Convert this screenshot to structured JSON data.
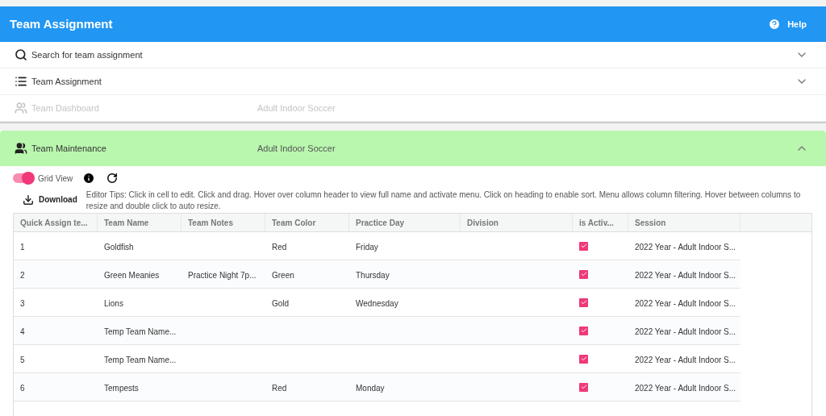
{
  "app_bar": {
    "title": "Team Assignment",
    "help": "Help"
  },
  "sections": [
    {
      "kind": "search",
      "label": "Search for team assignment",
      "expanded": false,
      "disabled": false
    },
    {
      "kind": "list",
      "label": "Team Assignment",
      "expanded": false,
      "disabled": false
    },
    {
      "kind": "people",
      "label": "Team Dashboard",
      "subtitle": "Adult Indoor Soccer",
      "disabled": true
    }
  ],
  "maintenance": {
    "label": "Team Maintenance",
    "subtitle": "Adult Indoor Soccer",
    "expanded": true
  },
  "grid_view": {
    "label": "Grid View",
    "on": true
  },
  "download": "Download",
  "tips": "Editor Tips: Click in cell to edit. Click and drag. Hover over column header to view full name and activate menu. Click on heading to enable sort. Menu allows column filtering. Hover between columns to resize and double click to auto resize.",
  "table": {
    "columns": [
      "Quick Assign te...",
      "Team Name",
      "Team Notes",
      "Team Color",
      "Practice Day",
      "Division",
      "is Activ...",
      "Session"
    ],
    "rows": [
      {
        "cells": [
          "1",
          "Goldfish",
          "",
          "Red",
          "Friday",
          ""
        ],
        "active": true,
        "session": "2022 Year - Adult Indoor S..."
      },
      {
        "cells": [
          "2",
          "Green Meanies",
          "Practice Night 7p...",
          "Green",
          "Thursday",
          ""
        ],
        "active": true,
        "session": "2022 Year - Adult Indoor S..."
      },
      {
        "cells": [
          "3",
          "Lions",
          "",
          "Gold",
          "Wednesday",
          ""
        ],
        "active": true,
        "session": "2022 Year - Adult Indoor S..."
      },
      {
        "cells": [
          "4",
          "Temp Team Name...",
          "",
          "",
          "",
          ""
        ],
        "active": true,
        "session": "2022 Year - Adult Indoor S..."
      },
      {
        "cells": [
          "5",
          "Temp Team Name...",
          "",
          "",
          "",
          ""
        ],
        "active": true,
        "session": "2022 Year - Adult Indoor S..."
      },
      {
        "cells": [
          "6",
          "Tempests",
          "",
          "Red",
          "Monday",
          ""
        ],
        "active": true,
        "session": "2022 Year - Adult Indoor S..."
      }
    ]
  }
}
